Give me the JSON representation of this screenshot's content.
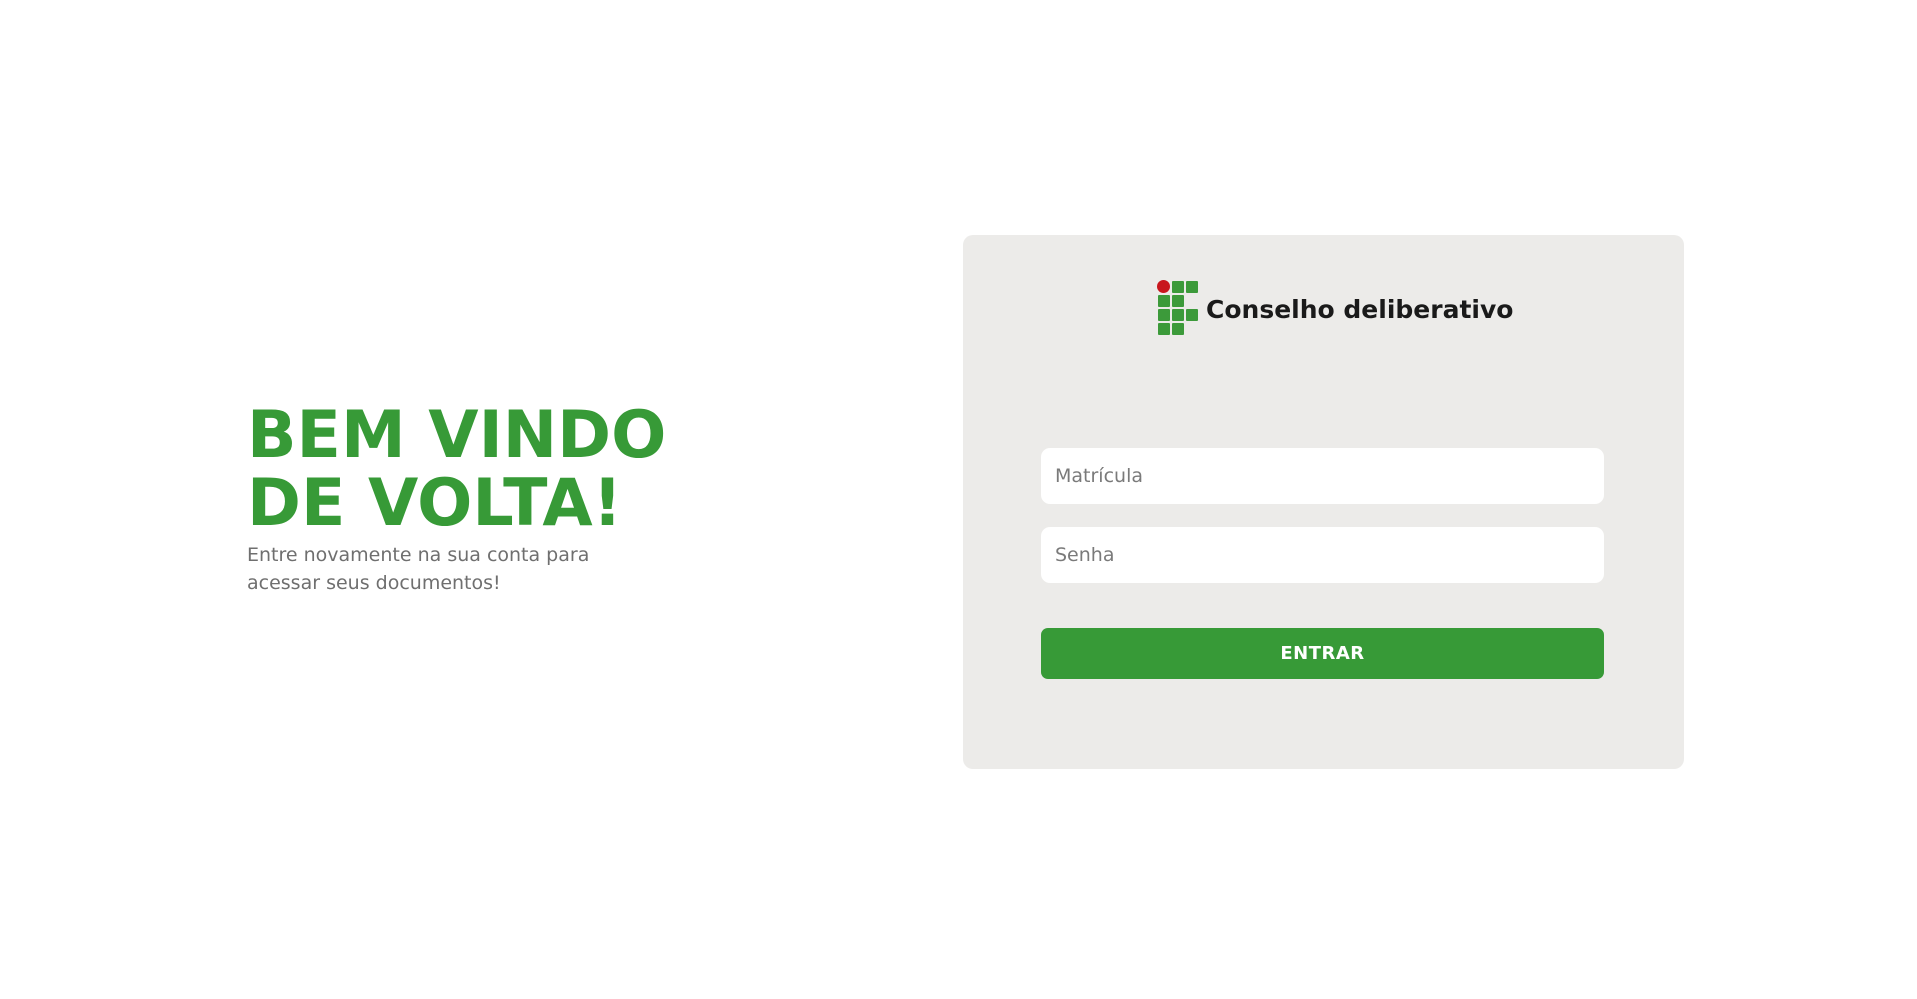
{
  "welcome": {
    "title_line1": "BEM VINDO",
    "title_line2": "DE VOLTA!",
    "subtitle": "Entre novamente na sua conta para acessar seus documentos!"
  },
  "brand": {
    "logo_icon": "institute-logo-icon",
    "name": "Conselho deliberativo"
  },
  "form": {
    "matricula_placeholder": "Matrícula",
    "senha_placeholder": "Senha",
    "submit_label": "ENTRAR"
  },
  "colors": {
    "primary_green": "#379a37",
    "logo_red": "#c8161d",
    "card_background": "#ecebe9",
    "subtitle_gray": "#6f6f6f"
  }
}
